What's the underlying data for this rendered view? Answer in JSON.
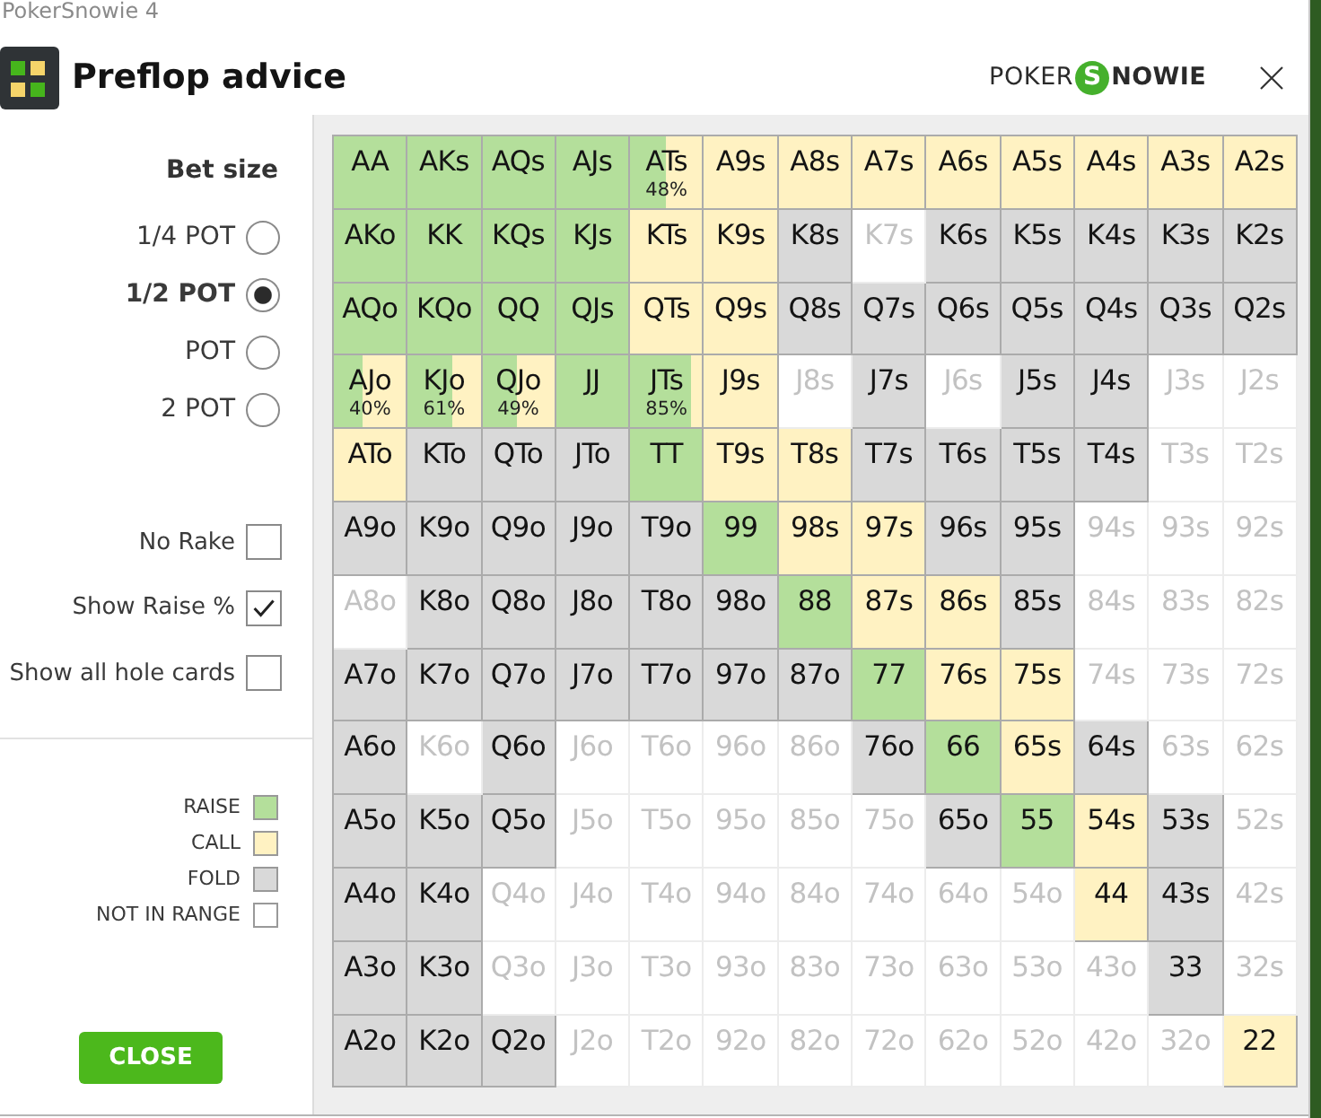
{
  "window": {
    "title": "PokerSnowie 4"
  },
  "dialog": {
    "title": "Preflop advice",
    "logo": {
      "left": "POKER",
      "mark": "S",
      "right": "NOWIE"
    }
  },
  "bet_size": {
    "heading": "Bet size",
    "options": [
      {
        "label": "1/4 POT",
        "selected": false
      },
      {
        "label": "1/2 POT",
        "selected": true
      },
      {
        "label": "POT",
        "selected": false
      },
      {
        "label": "2 POT",
        "selected": false
      }
    ]
  },
  "toggles": [
    {
      "label": "No Rake",
      "checked": false
    },
    {
      "label": "Show Raise %",
      "checked": true
    },
    {
      "label": "Show all hole cards",
      "checked": false
    }
  ],
  "legend": [
    {
      "label": "RAISE",
      "kind": "raise",
      "color": "#b4df9b"
    },
    {
      "label": "CALL",
      "kind": "call",
      "color": "#fff2c2"
    },
    {
      "label": "FOLD",
      "kind": "fold",
      "color": "#d9d9d9"
    },
    {
      "label": "NOT IN RANGE",
      "kind": "none",
      "color": "#ffffff"
    }
  ],
  "close_button": "CLOSE",
  "hand_grid": {
    "rows": [
      {
        "cells": [
          {
            "hand": "AA",
            "kind": "raise"
          },
          {
            "hand": "AKs",
            "kind": "raise"
          },
          {
            "hand": "AQs",
            "kind": "raise"
          },
          {
            "hand": "AJs",
            "kind": "raise"
          },
          {
            "hand": "ATs",
            "kind": "mixed",
            "level": 0.48,
            "percent": "48%"
          },
          {
            "hand": "A9s",
            "kind": "call"
          },
          {
            "hand": "A8s",
            "kind": "call"
          },
          {
            "hand": "A7s",
            "kind": "call"
          },
          {
            "hand": "A6s",
            "kind": "call"
          },
          {
            "hand": "A5s",
            "kind": "call"
          },
          {
            "hand": "A4s",
            "kind": "call"
          },
          {
            "hand": "A3s",
            "kind": "call"
          },
          {
            "hand": "A2s",
            "kind": "call"
          }
        ]
      },
      {
        "cells": [
          {
            "hand": "AKo",
            "kind": "raise"
          },
          {
            "hand": "KK",
            "kind": "raise"
          },
          {
            "hand": "KQs",
            "kind": "raise"
          },
          {
            "hand": "KJs",
            "kind": "raise"
          },
          {
            "hand": "KTs",
            "kind": "call"
          },
          {
            "hand": "K9s",
            "kind": "call"
          },
          {
            "hand": "K8s",
            "kind": "fold"
          },
          {
            "hand": "K7s",
            "kind": "none"
          },
          {
            "hand": "K6s",
            "kind": "fold"
          },
          {
            "hand": "K5s",
            "kind": "fold"
          },
          {
            "hand": "K4s",
            "kind": "fold"
          },
          {
            "hand": "K3s",
            "kind": "fold"
          },
          {
            "hand": "K2s",
            "kind": "fold"
          }
        ]
      },
      {
        "cells": [
          {
            "hand": "AQo",
            "kind": "raise"
          },
          {
            "hand": "KQo",
            "kind": "raise"
          },
          {
            "hand": "QQ",
            "kind": "raise"
          },
          {
            "hand": "QJs",
            "kind": "raise"
          },
          {
            "hand": "QTs",
            "kind": "call"
          },
          {
            "hand": "Q9s",
            "kind": "call"
          },
          {
            "hand": "Q8s",
            "kind": "fold"
          },
          {
            "hand": "Q7s",
            "kind": "fold"
          },
          {
            "hand": "Q6s",
            "kind": "fold"
          },
          {
            "hand": "Q5s",
            "kind": "fold"
          },
          {
            "hand": "Q4s",
            "kind": "fold"
          },
          {
            "hand": "Q3s",
            "kind": "fold"
          },
          {
            "hand": "Q2s",
            "kind": "fold"
          }
        ]
      },
      {
        "cells": [
          {
            "hand": "AJo",
            "kind": "mixed",
            "level": 0.4,
            "percent": "40%"
          },
          {
            "hand": "KJo",
            "kind": "mixed",
            "level": 0.61,
            "percent": "61%"
          },
          {
            "hand": "QJo",
            "kind": "mixed",
            "level": 0.49,
            "percent": "49%"
          },
          {
            "hand": "JJ",
            "kind": "raise"
          },
          {
            "hand": "JTs",
            "kind": "mixed",
            "level": 0.85,
            "percent": "85%"
          },
          {
            "hand": "J9s",
            "kind": "call"
          },
          {
            "hand": "J8s",
            "kind": "none"
          },
          {
            "hand": "J7s",
            "kind": "fold"
          },
          {
            "hand": "J6s",
            "kind": "none"
          },
          {
            "hand": "J5s",
            "kind": "fold"
          },
          {
            "hand": "J4s",
            "kind": "fold"
          },
          {
            "hand": "J3s",
            "kind": "none"
          },
          {
            "hand": "J2s",
            "kind": "none"
          }
        ]
      },
      {
        "cells": [
          {
            "hand": "ATo",
            "kind": "call"
          },
          {
            "hand": "KTo",
            "kind": "fold"
          },
          {
            "hand": "QTo",
            "kind": "fold"
          },
          {
            "hand": "JTo",
            "kind": "fold"
          },
          {
            "hand": "TT",
            "kind": "raise"
          },
          {
            "hand": "T9s",
            "kind": "call"
          },
          {
            "hand": "T8s",
            "kind": "call"
          },
          {
            "hand": "T7s",
            "kind": "fold"
          },
          {
            "hand": "T6s",
            "kind": "fold"
          },
          {
            "hand": "T5s",
            "kind": "fold"
          },
          {
            "hand": "T4s",
            "kind": "fold"
          },
          {
            "hand": "T3s",
            "kind": "none"
          },
          {
            "hand": "T2s",
            "kind": "none"
          }
        ]
      },
      {
        "cells": [
          {
            "hand": "A9o",
            "kind": "fold"
          },
          {
            "hand": "K9o",
            "kind": "fold"
          },
          {
            "hand": "Q9o",
            "kind": "fold"
          },
          {
            "hand": "J9o",
            "kind": "fold"
          },
          {
            "hand": "T9o",
            "kind": "fold"
          },
          {
            "hand": "99",
            "kind": "raise"
          },
          {
            "hand": "98s",
            "kind": "call"
          },
          {
            "hand": "97s",
            "kind": "call"
          },
          {
            "hand": "96s",
            "kind": "fold"
          },
          {
            "hand": "95s",
            "kind": "fold"
          },
          {
            "hand": "94s",
            "kind": "none"
          },
          {
            "hand": "93s",
            "kind": "none"
          },
          {
            "hand": "92s",
            "kind": "none"
          }
        ]
      },
      {
        "cells": [
          {
            "hand": "A8o",
            "kind": "none"
          },
          {
            "hand": "K8o",
            "kind": "fold"
          },
          {
            "hand": "Q8o",
            "kind": "fold"
          },
          {
            "hand": "J8o",
            "kind": "fold"
          },
          {
            "hand": "T8o",
            "kind": "fold"
          },
          {
            "hand": "98o",
            "kind": "fold"
          },
          {
            "hand": "88",
            "kind": "raise"
          },
          {
            "hand": "87s",
            "kind": "call"
          },
          {
            "hand": "86s",
            "kind": "call"
          },
          {
            "hand": "85s",
            "kind": "fold"
          },
          {
            "hand": "84s",
            "kind": "none"
          },
          {
            "hand": "83s",
            "kind": "none"
          },
          {
            "hand": "82s",
            "kind": "none"
          }
        ]
      },
      {
        "cells": [
          {
            "hand": "A7o",
            "kind": "fold"
          },
          {
            "hand": "K7o",
            "kind": "fold"
          },
          {
            "hand": "Q7o",
            "kind": "fold"
          },
          {
            "hand": "J7o",
            "kind": "fold"
          },
          {
            "hand": "T7o",
            "kind": "fold"
          },
          {
            "hand": "97o",
            "kind": "fold"
          },
          {
            "hand": "87o",
            "kind": "fold"
          },
          {
            "hand": "77",
            "kind": "raise"
          },
          {
            "hand": "76s",
            "kind": "call"
          },
          {
            "hand": "75s",
            "kind": "call"
          },
          {
            "hand": "74s",
            "kind": "none"
          },
          {
            "hand": "73s",
            "kind": "none"
          },
          {
            "hand": "72s",
            "kind": "none"
          }
        ]
      },
      {
        "cells": [
          {
            "hand": "A6o",
            "kind": "fold"
          },
          {
            "hand": "K6o",
            "kind": "none"
          },
          {
            "hand": "Q6o",
            "kind": "fold"
          },
          {
            "hand": "J6o",
            "kind": "none"
          },
          {
            "hand": "T6o",
            "kind": "none"
          },
          {
            "hand": "96o",
            "kind": "none"
          },
          {
            "hand": "86o",
            "kind": "none"
          },
          {
            "hand": "76o",
            "kind": "fold"
          },
          {
            "hand": "66",
            "kind": "raise"
          },
          {
            "hand": "65s",
            "kind": "call"
          },
          {
            "hand": "64s",
            "kind": "fold"
          },
          {
            "hand": "63s",
            "kind": "none"
          },
          {
            "hand": "62s",
            "kind": "none"
          }
        ]
      },
      {
        "cells": [
          {
            "hand": "A5o",
            "kind": "fold"
          },
          {
            "hand": "K5o",
            "kind": "fold"
          },
          {
            "hand": "Q5o",
            "kind": "fold"
          },
          {
            "hand": "J5o",
            "kind": "none"
          },
          {
            "hand": "T5o",
            "kind": "none"
          },
          {
            "hand": "95o",
            "kind": "none"
          },
          {
            "hand": "85o",
            "kind": "none"
          },
          {
            "hand": "75o",
            "kind": "none"
          },
          {
            "hand": "65o",
            "kind": "fold"
          },
          {
            "hand": "55",
            "kind": "raise"
          },
          {
            "hand": "54s",
            "kind": "call"
          },
          {
            "hand": "53s",
            "kind": "fold"
          },
          {
            "hand": "52s",
            "kind": "none"
          }
        ]
      },
      {
        "cells": [
          {
            "hand": "A4o",
            "kind": "fold"
          },
          {
            "hand": "K4o",
            "kind": "fold"
          },
          {
            "hand": "Q4o",
            "kind": "none"
          },
          {
            "hand": "J4o",
            "kind": "none"
          },
          {
            "hand": "T4o",
            "kind": "none"
          },
          {
            "hand": "94o",
            "kind": "none"
          },
          {
            "hand": "84o",
            "kind": "none"
          },
          {
            "hand": "74o",
            "kind": "none"
          },
          {
            "hand": "64o",
            "kind": "none"
          },
          {
            "hand": "54o",
            "kind": "none"
          },
          {
            "hand": "44",
            "kind": "call"
          },
          {
            "hand": "43s",
            "kind": "fold"
          },
          {
            "hand": "42s",
            "kind": "none"
          }
        ]
      },
      {
        "cells": [
          {
            "hand": "A3o",
            "kind": "fold"
          },
          {
            "hand": "K3o",
            "kind": "fold"
          },
          {
            "hand": "Q3o",
            "kind": "none"
          },
          {
            "hand": "J3o",
            "kind": "none"
          },
          {
            "hand": "T3o",
            "kind": "none"
          },
          {
            "hand": "93o",
            "kind": "none"
          },
          {
            "hand": "83o",
            "kind": "none"
          },
          {
            "hand": "73o",
            "kind": "none"
          },
          {
            "hand": "63o",
            "kind": "none"
          },
          {
            "hand": "53o",
            "kind": "none"
          },
          {
            "hand": "43o",
            "kind": "none"
          },
          {
            "hand": "33",
            "kind": "fold"
          },
          {
            "hand": "32s",
            "kind": "none"
          }
        ]
      },
      {
        "cells": [
          {
            "hand": "A2o",
            "kind": "fold"
          },
          {
            "hand": "K2o",
            "kind": "fold"
          },
          {
            "hand": "Q2o",
            "kind": "fold"
          },
          {
            "hand": "J2o",
            "kind": "none"
          },
          {
            "hand": "T2o",
            "kind": "none"
          },
          {
            "hand": "92o",
            "kind": "none"
          },
          {
            "hand": "82o",
            "kind": "none"
          },
          {
            "hand": "72o",
            "kind": "none"
          },
          {
            "hand": "62o",
            "kind": "none"
          },
          {
            "hand": "52o",
            "kind": "none"
          },
          {
            "hand": "42o",
            "kind": "none"
          },
          {
            "hand": "32o",
            "kind": "none"
          },
          {
            "hand": "22",
            "kind": "call"
          }
        ]
      }
    ]
  }
}
